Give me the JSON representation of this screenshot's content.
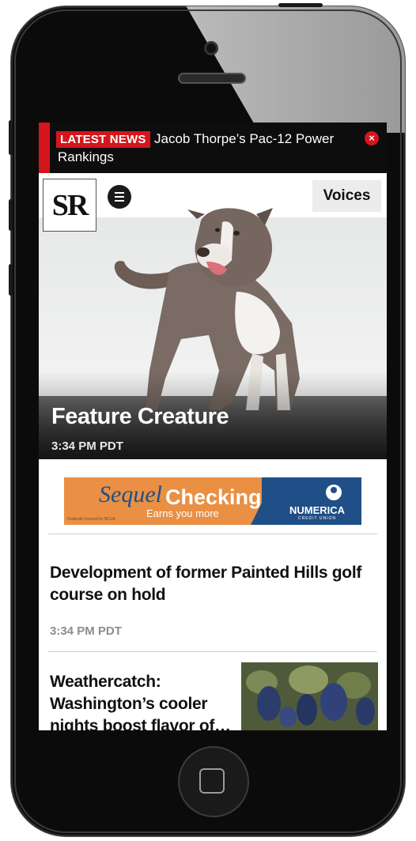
{
  "ticker": {
    "badge": "LATEST NEWS",
    "text": "Jacob Thorpe’s Pac-12 Power Rankings",
    "close_icon": "close-circle-icon"
  },
  "header": {
    "logo": "SR",
    "menu_icon": "hamburger-menu-icon",
    "voices_label": "Voices"
  },
  "hero": {
    "title": "Feature Creature",
    "time": "3:34 PM PDT"
  },
  "ad": {
    "word1": "Sequel",
    "word2": "Checking",
    "tagline": "Earns you more",
    "brand": "NUMERICA",
    "brand_sub": "CREDIT UNION",
    "fine_print": "Federally Insured by NCUA"
  },
  "stories": [
    {
      "headline": "Development of former Painted Hills golf course on hold",
      "time": "3:34 PM PDT"
    },
    {
      "headline": "Weathercatch: Washington’s cooler nights boost flavor of…"
    }
  ],
  "colors": {
    "accent_red": "#d4161c",
    "ad_orange": "#e99045",
    "ad_navy": "#1f4f86"
  }
}
